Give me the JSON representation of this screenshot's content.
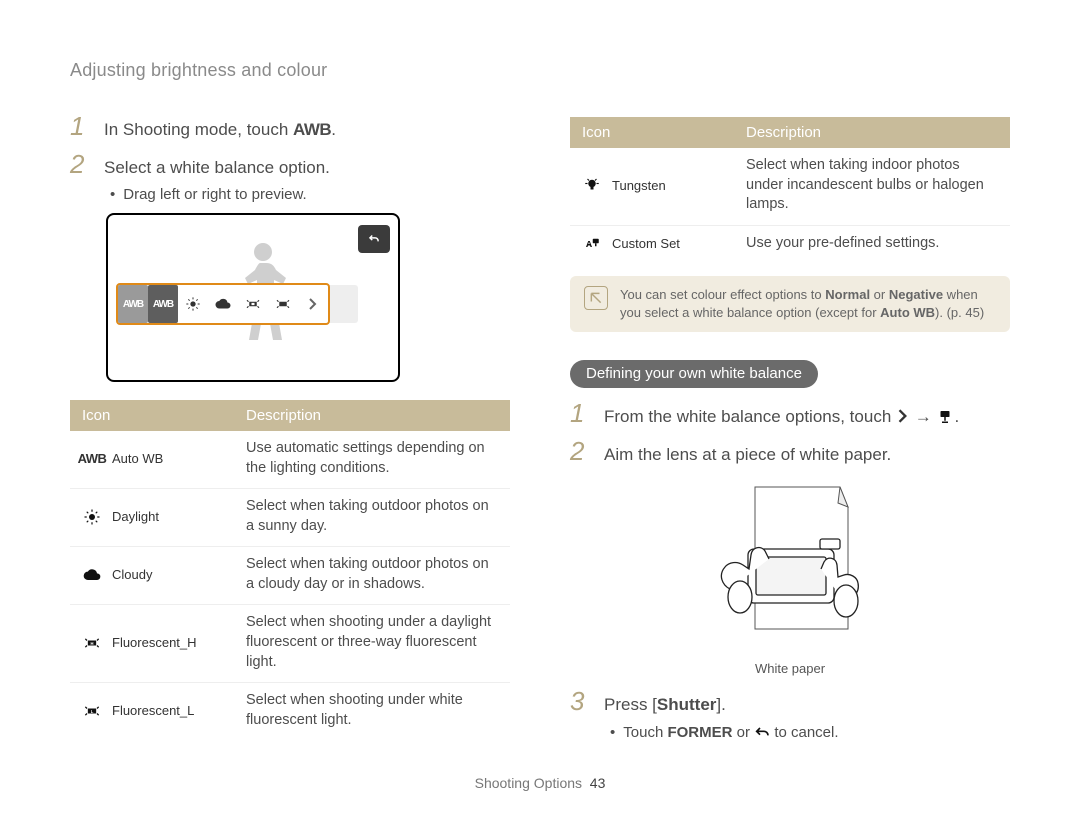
{
  "header": {
    "breadcrumb": "Adjusting brightness and colour"
  },
  "left": {
    "step1": {
      "num": "1",
      "pre": "In Shooting mode, touch ",
      "icon": "AWB",
      "post": "."
    },
    "step2": {
      "num": "2",
      "text": "Select a white balance option."
    },
    "bullet1": "Drag left or right to preview.",
    "screen": {
      "chips": [
        "AWB",
        "AWB",
        "",
        "",
        "",
        "",
        ">"
      ],
      "back_icon": "↶"
    },
    "table": {
      "headers": {
        "icon": "Icon",
        "desc": "Description"
      },
      "rows": [
        {
          "name": "Auto WB",
          "icon_type": "awb",
          "desc": "Use automatic settings depending on the lighting conditions."
        },
        {
          "name": "Daylight",
          "icon_type": "sun",
          "desc": "Select when taking outdoor photos on a sunny day."
        },
        {
          "name": "Cloudy",
          "icon_type": "cloud",
          "desc": "Select when taking outdoor photos on a cloudy day or in shadows."
        },
        {
          "name": "Fluorescent_H",
          "icon_type": "fluoH",
          "desc": "Select when shooting under a daylight fluorescent or three-way fluorescent light."
        },
        {
          "name": "Fluorescent_L",
          "icon_type": "fluoL",
          "desc": "Select when shooting under white fluorescent light."
        }
      ]
    }
  },
  "right": {
    "table": {
      "headers": {
        "icon": "Icon",
        "desc": "Description"
      },
      "rows": [
        {
          "name": "Tungsten",
          "icon_type": "bulb",
          "desc": "Select when taking indoor photos under incandescent bulbs or halogen lamps."
        },
        {
          "name": "Custom Set",
          "icon_type": "custom",
          "desc": "Use your pre-defined settings."
        }
      ]
    },
    "note": {
      "pre": "You can set colour effect options to ",
      "b1": "Normal",
      "mid": " or ",
      "b2": "Negative",
      "post1": " when you select a white balance option (except for ",
      "b3": "Auto WB",
      "post2": "). (p. 45)"
    },
    "section_title": "Defining your own white balance",
    "step1": {
      "num": "1",
      "pre": "From the white balance options, touch ",
      "sep": " → ",
      "post": "."
    },
    "step2": {
      "num": "2",
      "text": "Aim the lens at a piece of white paper."
    },
    "diagram_label": "White paper",
    "step3": {
      "num": "3",
      "pre": "Press [",
      "b": "Shutter",
      "post": "]."
    },
    "bullet3": {
      "pre": "Touch ",
      "former": "FORMER",
      "mid": " or ",
      "post": " to cancel."
    }
  },
  "footer": {
    "section": "Shooting Options",
    "page": "43"
  }
}
